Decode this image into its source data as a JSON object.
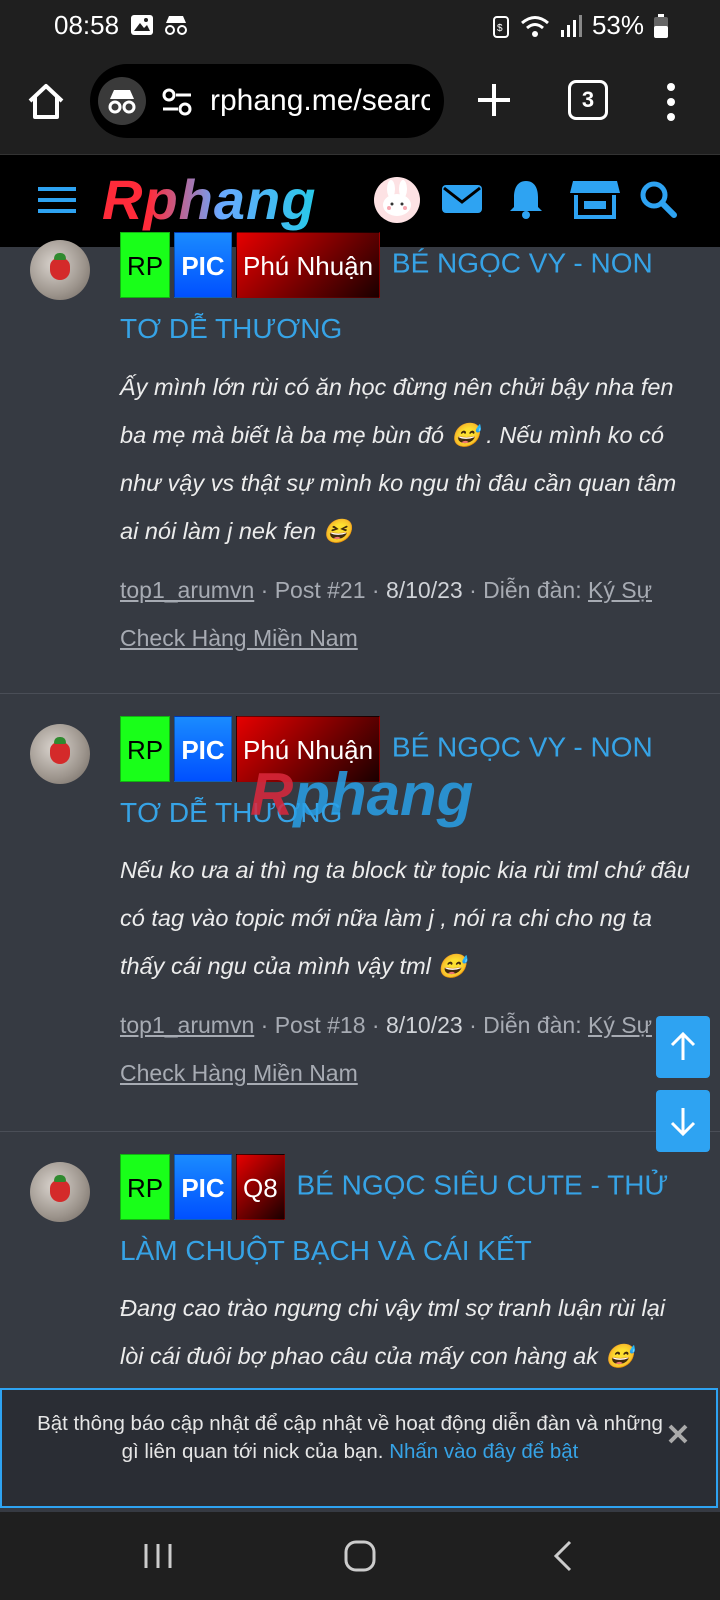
{
  "status_bar": {
    "time": "08:58",
    "battery": "53%"
  },
  "browser": {
    "url": "rphang.me/search",
    "tab_count": "3"
  },
  "site_header": {
    "logo": "Rphang"
  },
  "posts": [
    {
      "badges": [
        "RP",
        "PIC",
        "Phú Nhuận"
      ],
      "title": "BÉ NGỌC VY - NON TƠ DỄ THƯƠNG",
      "excerpt": "Ấy mình lớn rùi có ăn học đừng nên chửi bậy nha fen ba mẹ mà biết là ba mẹ bùn đó 😅 . Nếu mình ko có như vậy vs thật sự mình ko ngu thì đâu cần quan tâm ai nói làm j nek fen 😆",
      "author": "top1_arumvn",
      "post_no": "Post #21",
      "date": "8/10/23",
      "forum_label": "Diễn đàn:",
      "forum": "Ký Sự Check Hàng Miền Nam"
    },
    {
      "badges": [
        "RP",
        "PIC",
        "Phú Nhuận"
      ],
      "title": "BÉ NGỌC VY - NON TƠ DỄ THƯƠNG",
      "excerpt": "Nếu ko ưa ai thì ng ta block từ topic kia rùi tml chứ đâu có tag vào topic mới nữa làm j , nói ra chi cho ng ta thấy cái ngu của mình vậy tml 😅",
      "author": "top1_arumvn",
      "post_no": "Post #18",
      "date": "8/10/23",
      "forum_label": "Diễn đàn:",
      "forum": "Ký Sự Check Hàng Miền Nam"
    },
    {
      "badges": [
        "RP",
        "PIC",
        "Q8"
      ],
      "title": "BÉ NGỌC SIÊU CUTE - THỬ LÀM CHUỘT BẠCH VÀ CÁI KẾT",
      "excerpt": "Đang cao trào ngưng chi vậy tml sợ tranh luận rùi lại lòi cái đuôi bợ phao câu của mấy con hàng ak 😅"
    }
  ],
  "watermark": {
    "part1": "R",
    "part2": "phang"
  },
  "notification": {
    "text": "Bật thông báo cập nhật để cập nhật về hoạt động diễn đàn và những gì liên quan tới nick của bạn.",
    "link": "Nhấn vào đây để bật"
  },
  "colors": {
    "accent": "#2ea3f2",
    "page_bg": "#363a42",
    "badge_rp": "#19ff19",
    "badge_pic": "#1a6bff",
    "badge_loc": "#c40000"
  }
}
